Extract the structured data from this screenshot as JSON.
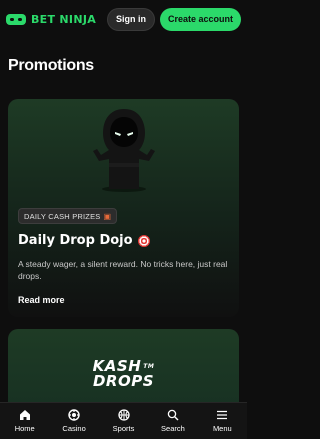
{
  "header": {
    "logo_text": "BET NINJA",
    "signin_label": "Sign in",
    "create_label": "Create account"
  },
  "page": {
    "title": "Promotions"
  },
  "promos": [
    {
      "badge": "DAILY CASH PRIZES",
      "badge_icon": "gift-icon",
      "title": "Daily Drop Dojo",
      "title_icon": "target-icon",
      "description": "A steady wager, a silent reward. No tricks here, just real drops.",
      "cta": "Read more"
    },
    {
      "logo_line1": "KASH",
      "logo_line2": "DROPS",
      "logo_tm": "TM"
    }
  ],
  "nav": [
    {
      "label": "Home",
      "icon": "home-icon"
    },
    {
      "label": "Casino",
      "icon": "casino-chip-icon"
    },
    {
      "label": "Sports",
      "icon": "basketball-icon"
    },
    {
      "label": "Search",
      "icon": "search-icon"
    },
    {
      "label": "Menu",
      "icon": "menu-icon"
    }
  ],
  "colors": {
    "accent": "#2bd96a",
    "background": "#0e0e0e",
    "card_green": "#1e3b25"
  }
}
